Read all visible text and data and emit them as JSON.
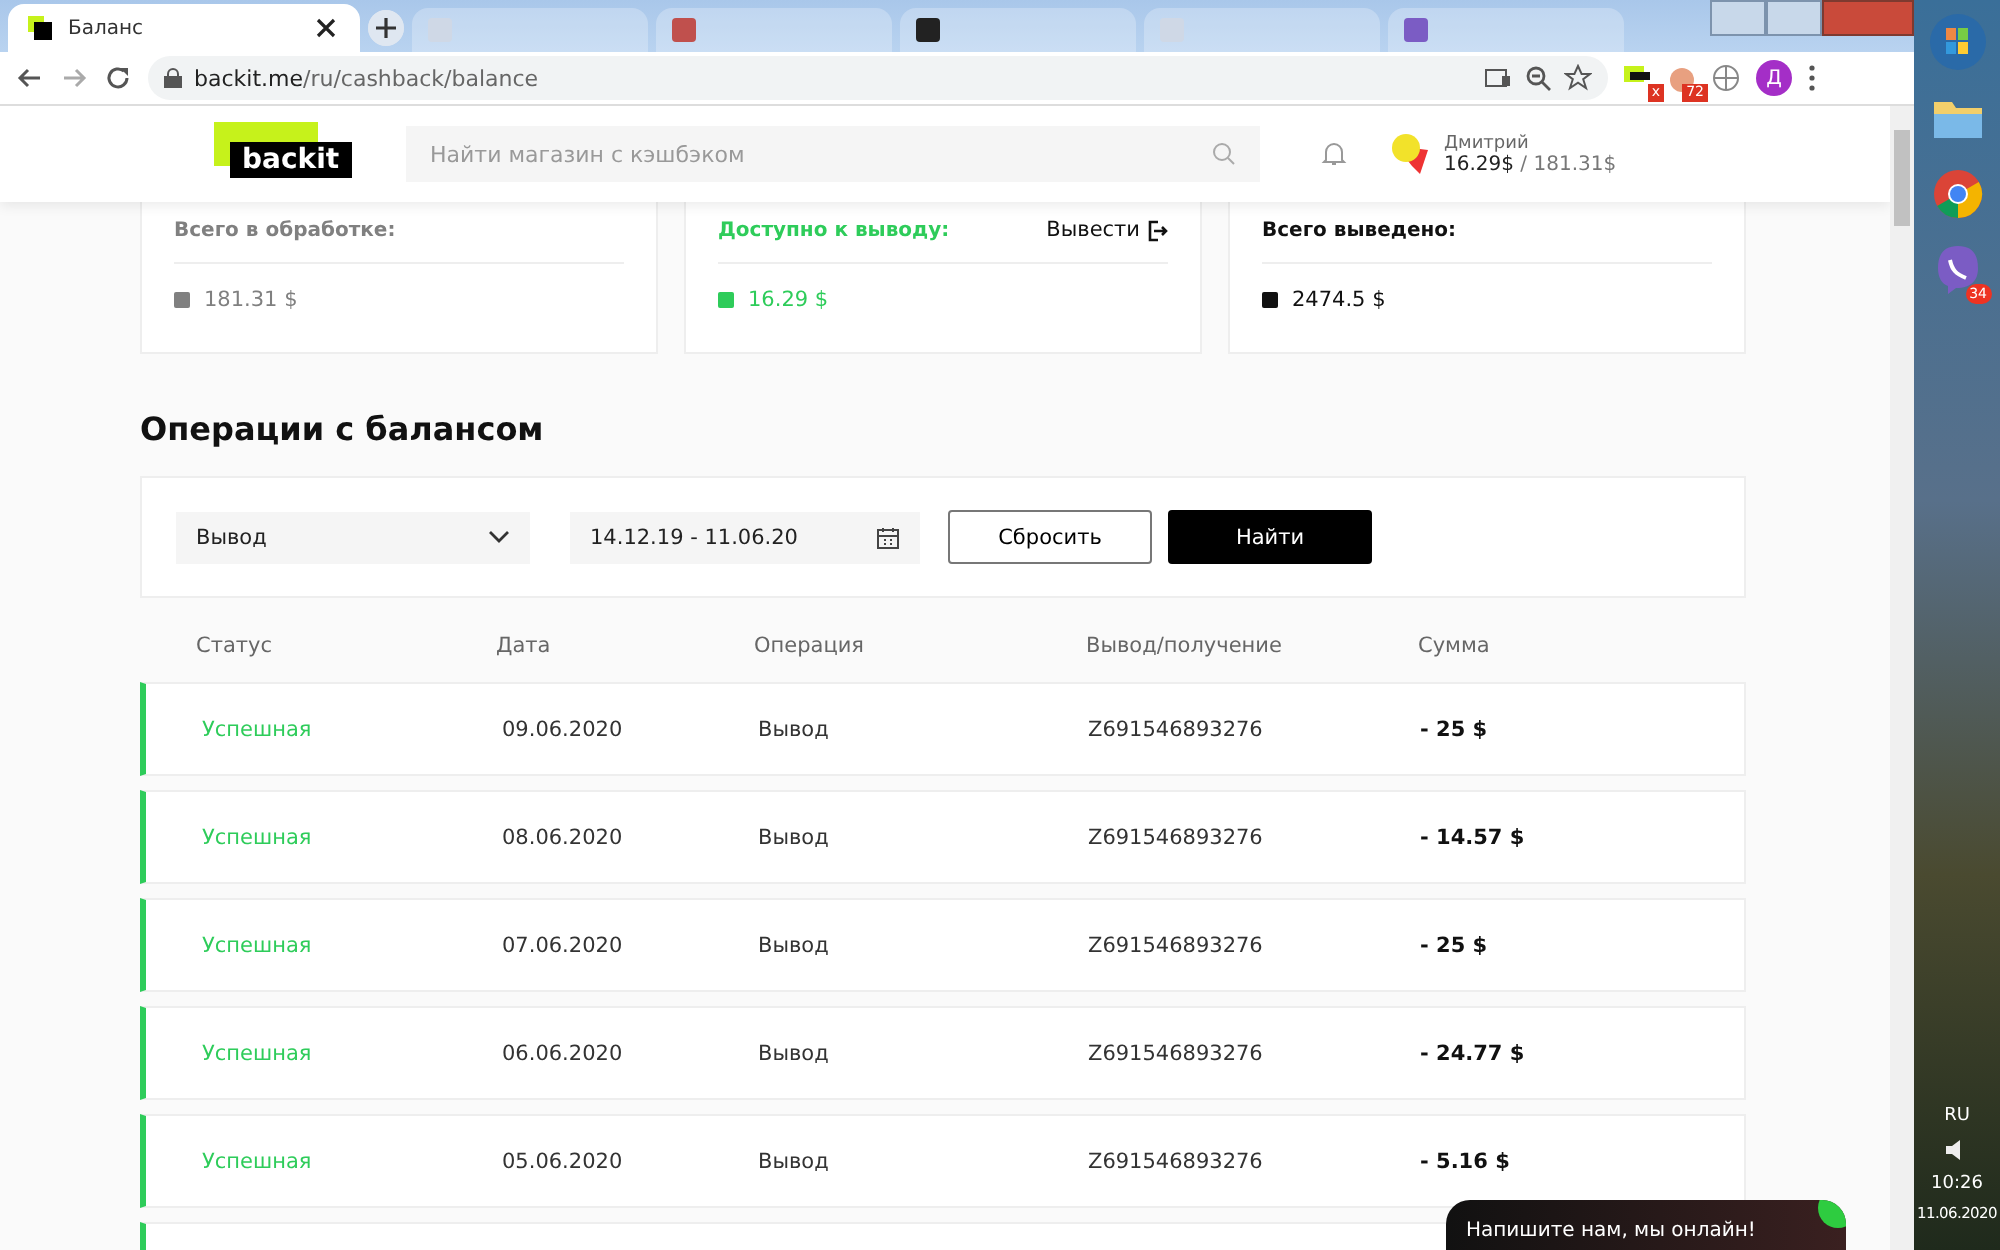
{
  "browser": {
    "active_tab": {
      "title": "Баланс"
    },
    "background_tabs": [
      {
        "color": "#cfd8e6"
      },
      {
        "color": "#c0504d"
      },
      {
        "color": "#222222"
      },
      {
        "color": "#cfd8e6"
      },
      {
        "color": "#7b5cc4"
      }
    ],
    "url_host": "backit.me",
    "url_path": "/ru/cashback/balance",
    "extension_badges": [
      "x",
      "72"
    ],
    "profile_initial": "Д"
  },
  "header": {
    "logo": "backit",
    "search": {
      "placeholder": "Найти магазин с кэшбэком"
    },
    "user": {
      "name": "Дмитрий",
      "available": "16.29$",
      "separator": " / ",
      "total": "181.31$"
    }
  },
  "cards": [
    {
      "label": "Всего в обработке:",
      "value": "181.31 $",
      "color": "#808080"
    },
    {
      "label": "Доступно к выводу:",
      "value": "16.29 $",
      "color": "#2ecc5a",
      "action": "Вывести"
    },
    {
      "label": "Всего выведено:",
      "value": "2474.5 $",
      "color": "#111111"
    }
  ],
  "section_title": "Операции с балансом",
  "filters": {
    "type": "Вывод",
    "dates": "14.12.19 - 11.06.20",
    "reset": "Сбросить",
    "find": "Найти"
  },
  "table": {
    "columns": [
      "Статус",
      "Дата",
      "Операция",
      "Вывод/получение",
      "Сумма"
    ],
    "rows": [
      {
        "status": "Успешная",
        "date": "09.06.2020",
        "operation": "Вывод",
        "account": "Z691546893276",
        "amount": "- 25 $"
      },
      {
        "status": "Успешная",
        "date": "08.06.2020",
        "operation": "Вывод",
        "account": "Z691546893276",
        "amount": "- 14.57 $"
      },
      {
        "status": "Успешная",
        "date": "07.06.2020",
        "operation": "Вывод",
        "account": "Z691546893276",
        "amount": "- 25 $"
      },
      {
        "status": "Успешная",
        "date": "06.06.2020",
        "operation": "Вывод",
        "account": "Z691546893276",
        "amount": "- 24.77 $"
      },
      {
        "status": "Успешная",
        "date": "05.06.2020",
        "operation": "Вывод",
        "account": "Z691546893276",
        "amount": "- 5.16 $"
      }
    ]
  },
  "chat": {
    "label": "Напишите нам, мы онлайн!"
  },
  "taskbar": {
    "apps_badge": "34",
    "language": "RU",
    "time": "10:26",
    "date": "11.06.2020"
  }
}
